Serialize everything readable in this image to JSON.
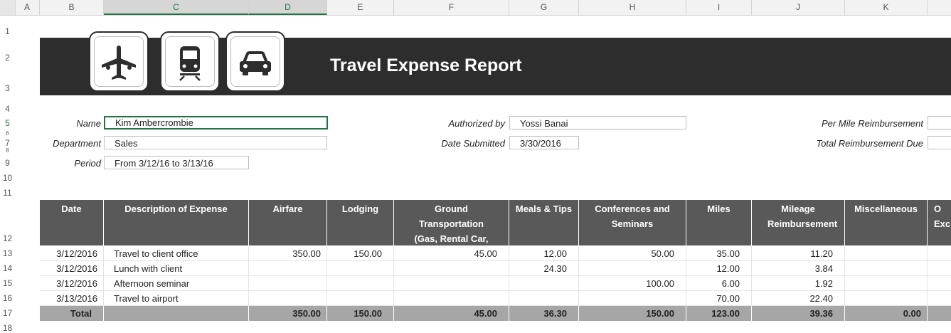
{
  "columns": [
    "A",
    "B",
    "C",
    "D",
    "E",
    "F",
    "G",
    "H",
    "I",
    "J",
    "K"
  ],
  "rows": [
    "1",
    "2",
    "3",
    "4",
    "5",
    "6",
    "7",
    "8",
    "9",
    "10",
    "11",
    "12",
    "13",
    "14",
    "15",
    "16",
    "17",
    "18"
  ],
  "title": "Travel Expense Report",
  "icons": [
    "airplane-icon",
    "train-icon",
    "car-icon"
  ],
  "form": {
    "name_label": "Name",
    "name_value": "Kim Ambercrombie",
    "department_label": "Department",
    "department_value": "Sales",
    "period_label": "Period",
    "period_value": "From 3/12/16 to 3/13/16",
    "authorized_label": "Authorized by",
    "authorized_value": "Yossi Banai",
    "submitted_label": "Date Submitted",
    "submitted_value": "3/30/2016",
    "per_mile_label": "Per Mile Reimbursement",
    "total_due_label": "Total Reimbursement Due"
  },
  "table": {
    "headers": [
      "Date",
      "Description of Expense",
      "Airfare",
      "Lodging",
      "Ground Transportation (Gas, Rental Car, Taxi)",
      "Meals & Tips",
      "Conferences and Seminars",
      "Miles",
      "Mileage Reimbursement",
      "Miscellaneous",
      "O Exch"
    ],
    "rows": [
      [
        "3/12/2016",
        "Travel to client office",
        "350.00",
        "150.00",
        "45.00",
        "12.00",
        "50.00",
        "35.00",
        "11.20",
        "",
        ""
      ],
      [
        "3/12/2016",
        "Lunch with client",
        "",
        "",
        "",
        "24.30",
        "",
        "12.00",
        "3.84",
        "",
        ""
      ],
      [
        "3/12/2016",
        "Afternoon seminar",
        "",
        "",
        "",
        "",
        "100.00",
        "6.00",
        "1.92",
        "",
        ""
      ],
      [
        "3/13/2016",
        "Travel to airport",
        "",
        "",
        "",
        "",
        "",
        "70.00",
        "22.40",
        "",
        ""
      ]
    ],
    "total": [
      "Total",
      "",
      "350.00",
      "150.00",
      "45.00",
      "36.30",
      "150.00",
      "123.00",
      "39.36",
      "0.00",
      ""
    ]
  },
  "colors": {
    "banner": "#2d2d2d",
    "header": "#595959",
    "total": "#a6a6a6",
    "accent": "#217346"
  }
}
